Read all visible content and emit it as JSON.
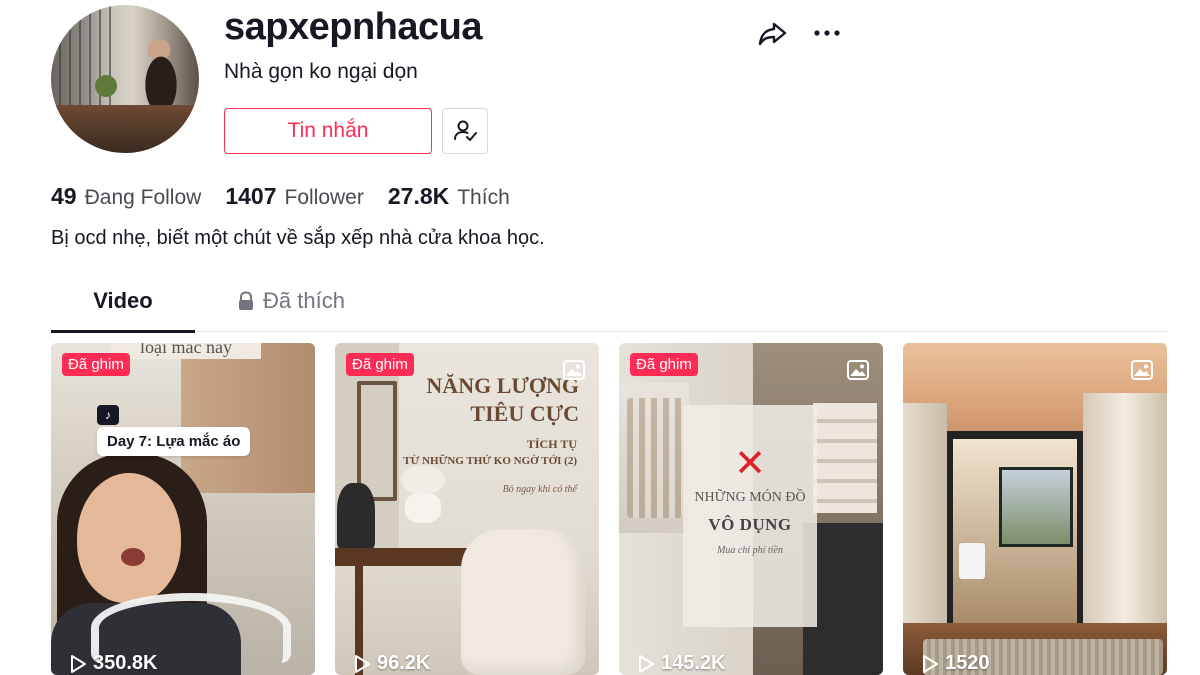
{
  "profile": {
    "username": "sapxepnhacua",
    "nickname": "Nhà gọn ko ngại dọn",
    "bio": "Bị ocd nhẹ, biết một chút về sắp xếp nhà cửa khoa học.",
    "message_button": "Tin nhắn"
  },
  "stats": {
    "following_count": "49",
    "following_label": "Đang Follow",
    "followers_count": "1407",
    "followers_label": "Follower",
    "likes_count": "27.8K",
    "likes_label": "Thích"
  },
  "tabs": {
    "video": "Video",
    "liked": "Đã thích",
    "active": "video"
  },
  "videos": [
    {
      "pinned_label": "Đã ghim",
      "views": "350.8K",
      "top_text": "loại mắc này",
      "caption": "Day 7: Lựa mắc áo",
      "is_photo": false
    },
    {
      "pinned_label": "Đã ghim",
      "views": "96.2K",
      "title_line1": "NĂNG LƯỢNG",
      "title_line2": "TIÊU CỰC",
      "sub_line1": "TÍCH TỤ",
      "sub_line2": "TỪ NHỮNG THỨ KO NGỜ TỚI (2)",
      "sub_line3": "Bỏ ngay khi có thể",
      "is_photo": true
    },
    {
      "pinned_label": "Đã ghim",
      "views": "145.2K",
      "mark": "✕",
      "line1": "NHỮNG MÓN ĐỒ",
      "line2": "VÔ DỤNG",
      "line3": "Mua chỉ phí tiền",
      "is_photo": true
    },
    {
      "views": "1520",
      "is_photo": true
    }
  ],
  "colors": {
    "accent": "#fe2c55",
    "text_primary": "#161823",
    "text_secondary": "#737480"
  },
  "icons": {
    "share": "share-arrow-icon",
    "more": "more-dots-icon",
    "follow": "user-check-icon",
    "lock": "lock-icon",
    "photo": "photo-icon",
    "play": "play-icon"
  }
}
